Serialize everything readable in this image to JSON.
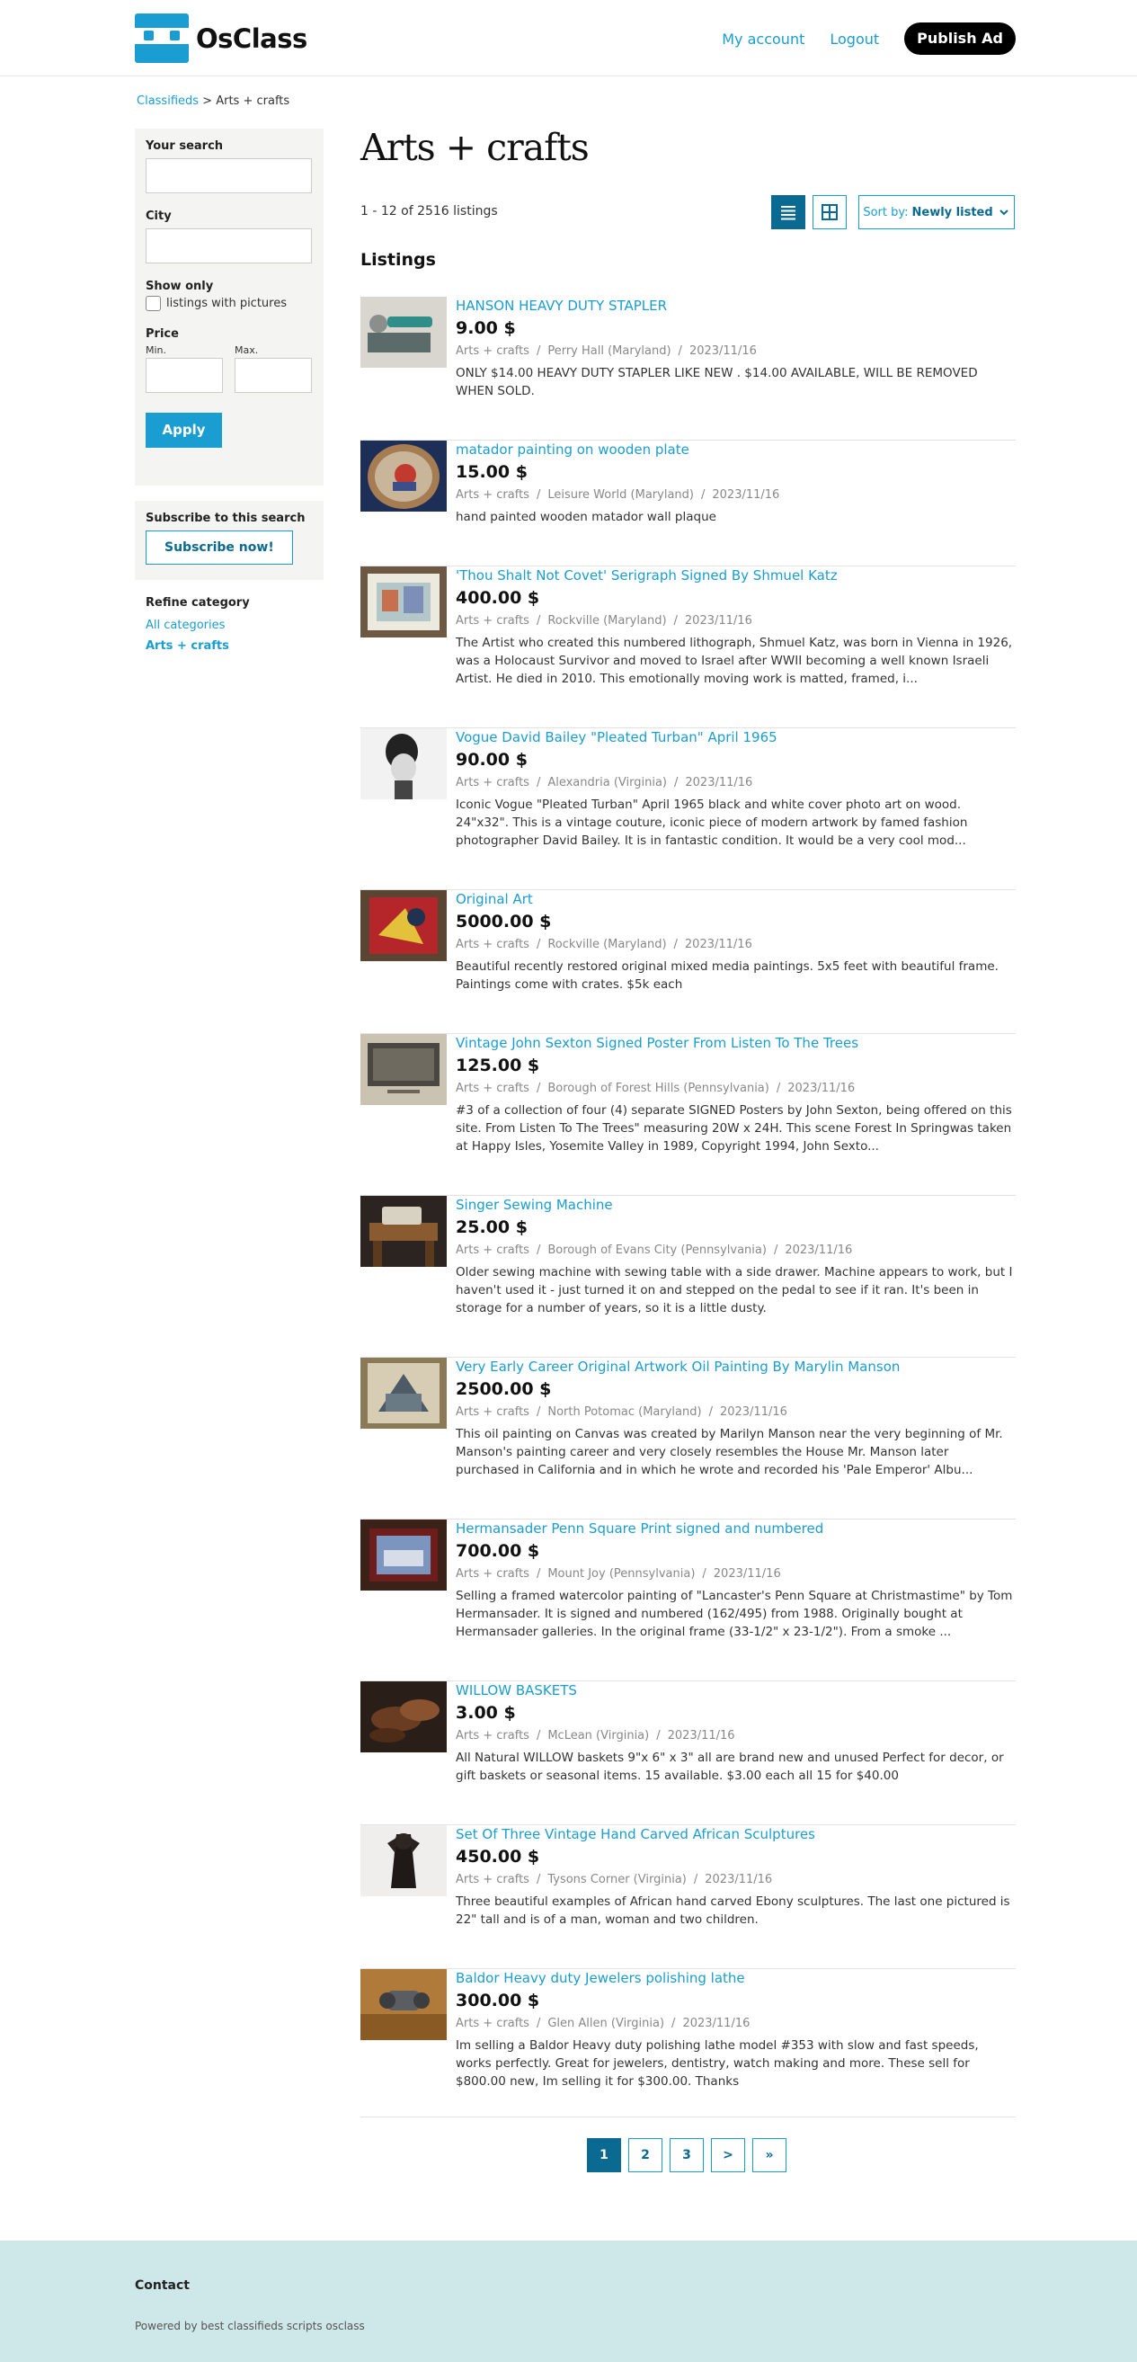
{
  "header": {
    "logo_text": "OsClass",
    "nav": {
      "my_account": "My account",
      "logout": "Logout",
      "publish": "Publish Ad"
    }
  },
  "breadcrumb": {
    "home": "Classifieds",
    "separator": ">",
    "current": "Arts + crafts"
  },
  "sidebar": {
    "your_search_label": "Your search",
    "your_search_value": "",
    "city_label": "City",
    "city_value": "",
    "show_only_label": "Show only",
    "pictures_label": "listings with pictures",
    "price_label": "Price",
    "min_label": "Min.",
    "max_label": "Max.",
    "apply_label": "Apply",
    "subscribe_title": "Subscribe to this search",
    "subscribe_button": "Subscribe now!",
    "refine_title": "Refine category",
    "refine_all": "All categories",
    "refine_current": "Arts + crafts"
  },
  "main": {
    "title": "Arts + crafts",
    "count": "1 - 12 of 2516 listings",
    "sort_prefix": "Sort by:",
    "sort_value": "Newly listed",
    "listings_heading": "Listings"
  },
  "listings": [
    {
      "title": "HANSON HEAVY DUTY STAPLER",
      "price": "9.00 $",
      "category": "Arts + crafts",
      "location": "Perry Hall (Maryland)",
      "date": "2023/11/16",
      "desc": "ONLY $14.00 HEAVY DUTY STAPLER LIKE NEW . $14.00 AVAILABLE, WILL BE REMOVED WHEN SOLD."
    },
    {
      "title": "matador painting on wooden plate",
      "price": "15.00 $",
      "category": "Arts + crafts",
      "location": "Leisure World (Maryland)",
      "date": "2023/11/16",
      "desc": "hand painted wooden matador wall plaque"
    },
    {
      "title": "'Thou Shalt Not Covet' Serigraph Signed By Shmuel Katz",
      "price": "400.00 $",
      "category": "Arts + crafts",
      "location": "Rockville (Maryland)",
      "date": "2023/11/16",
      "desc": "The Artist who created this numbered lithograph, Shmuel Katz, was born in Vienna in 1926, was a Holocaust Survivor and moved to Israel after WWII becoming a well known Israeli Artist. He died in 2010. This emotionally moving work is matted, framed, i..."
    },
    {
      "title": "Vogue David Bailey \"Pleated Turban\" April 1965",
      "price": "90.00 $",
      "category": "Arts + crafts",
      "location": "Alexandria (Virginia)",
      "date": "2023/11/16",
      "desc": "Iconic Vogue \"Pleated Turban\" April 1965 black and white cover photo art on wood. 24\"x32\". This is a vintage couture, iconic piece of modern artwork by famed fashion photographer David Bailey. It is in fantastic condition. It would be a very cool mod..."
    },
    {
      "title": "Original Art",
      "price": "5000.00 $",
      "category": "Arts + crafts",
      "location": "Rockville (Maryland)",
      "date": "2023/11/16",
      "desc": "Beautiful recently restored original mixed media paintings. 5x5 feet with beautiful frame. Paintings come with crates. $5k each"
    },
    {
      "title": "Vintage John Sexton Signed Poster From Listen To The Trees",
      "price": "125.00 $",
      "category": "Arts + crafts",
      "location": "Borough of Forest Hills (Pennsylvania)",
      "date": "2023/11/16",
      "desc": "#3 of a collection of four (4) separate SIGNED Posters by John Sexton, being offered on this site. From Listen To The Trees\" measuring 20W x 24H. This scene Forest In Springwas taken at Happy Isles, Yosemite Valley in 1989, Copyright 1994, John Sexto..."
    },
    {
      "title": "Singer Sewing Machine",
      "price": "25.00 $",
      "category": "Arts + crafts",
      "location": "Borough of Evans City (Pennsylvania)",
      "date": "2023/11/16",
      "desc": "Older sewing machine with sewing table with a side drawer. Machine appears to work, but I haven't used it - just turned it on and stepped on the pedal to see if it ran. It's been in storage for a number of years, so it is a little dusty."
    },
    {
      "title": "Very Early Career Original Artwork Oil Painting By Marylin Manson",
      "price": "2500.00 $",
      "category": "Arts + crafts",
      "location": "North Potomac (Maryland)",
      "date": "2023/11/16",
      "desc": "This oil painting on Canvas was created by Marilyn Manson near the very beginning of Mr. Manson's painting career and very closely resembles the House Mr. Manson later purchased in California and in which he wrote and recorded his 'Pale Emperor' Albu..."
    },
    {
      "title": "Hermansader Penn Square Print signed and numbered",
      "price": "700.00 $",
      "category": "Arts + crafts",
      "location": "Mount Joy (Pennsylvania)",
      "date": "2023/11/16",
      "desc": "Selling a framed watercolor painting of \"Lancaster's Penn Square at Christmastime\" by Tom Hermansader. It is signed and numbered (162/495) from 1988. Originally bought at Hermansader galleries. In the original frame (33-1/2\" x 23-1/2\"). From a smoke ..."
    },
    {
      "title": "WILLOW BASKETS",
      "price": "3.00 $",
      "category": "Arts + crafts",
      "location": "McLean (Virginia)",
      "date": "2023/11/16",
      "desc": "All Natural WILLOW baskets 9\"x 6\" x 3\" all are brand new and unused Perfect for decor, or gift baskets or seasonal items. 15 available. $3.00 each all 15 for $40.00"
    },
    {
      "title": "Set Of Three Vintage Hand Carved African Sculptures",
      "price": "450.00 $",
      "category": "Arts + crafts",
      "location": "Tysons Corner (Virginia)",
      "date": "2023/11/16",
      "desc": "Three beautiful examples of African hand carved Ebony sculptures. The last one pictured is 22\" tall and is of a man, woman and two children."
    },
    {
      "title": "Baldor Heavy duty Jewelers polishing lathe",
      "price": "300.00 $",
      "category": "Arts + crafts",
      "location": "Glen Allen (Virginia)",
      "date": "2023/11/16",
      "desc": "Im selling a Baldor Heavy duty polishing lathe model #353 with slow and fast speeds, works perfectly. Great for jewelers, dentistry, watch making and more. These sell for $800.00 new, Im selling it for $300.00. Thanks"
    }
  ],
  "pagination": [
    "1",
    "2",
    "3",
    ">",
    "»"
  ],
  "footer": {
    "contact": "Contact",
    "powered": "Powered by best classifieds scripts osclass"
  },
  "colors": {
    "accent": "#1a9dd0",
    "accent_dark": "#0b6a91",
    "footer_bg": "#cee7e8",
    "sidebar_bg": "#f4f4f2"
  }
}
